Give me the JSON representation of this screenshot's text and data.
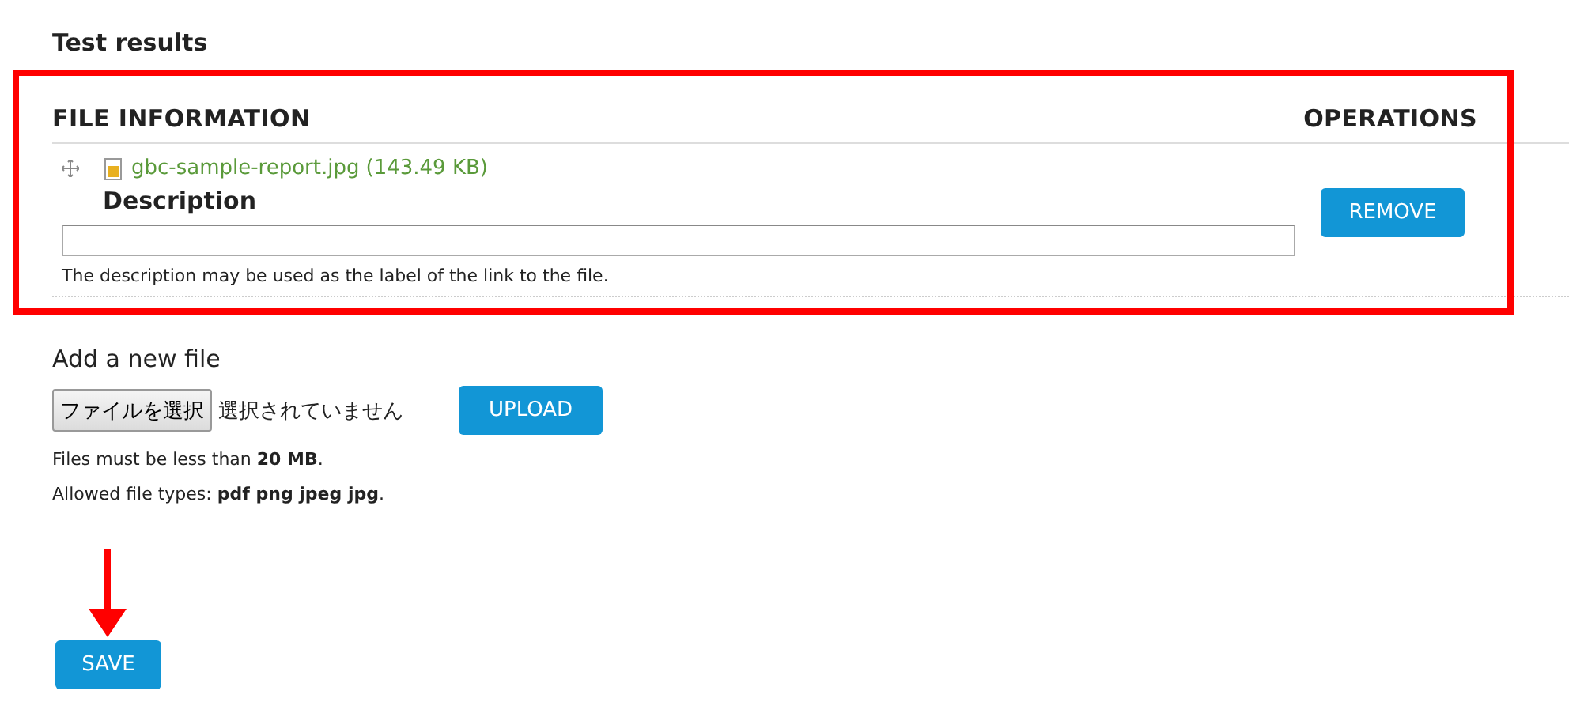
{
  "section_title": "Test results",
  "table": {
    "columns": [
      "FILE INFORMATION",
      "OPERATIONS"
    ],
    "rows": [
      {
        "file_name": "gbc-sample-report.jpg",
        "file_size": "(143.49 KB)",
        "description_label": "Description",
        "description_help": "The description may be used as the label of the link to the file.",
        "operation": "REMOVE"
      }
    ]
  },
  "add_file": {
    "title": "Add a new file",
    "choose_button": "ファイルを選択",
    "chosen_status": "選択されていません",
    "upload_button": "UPLOAD",
    "notes": [
      "Files must be less than **20 MB**.",
      "Allowed file types: **pdf png jpeg jpg**."
    ]
  },
  "save_button": "SAVE"
}
